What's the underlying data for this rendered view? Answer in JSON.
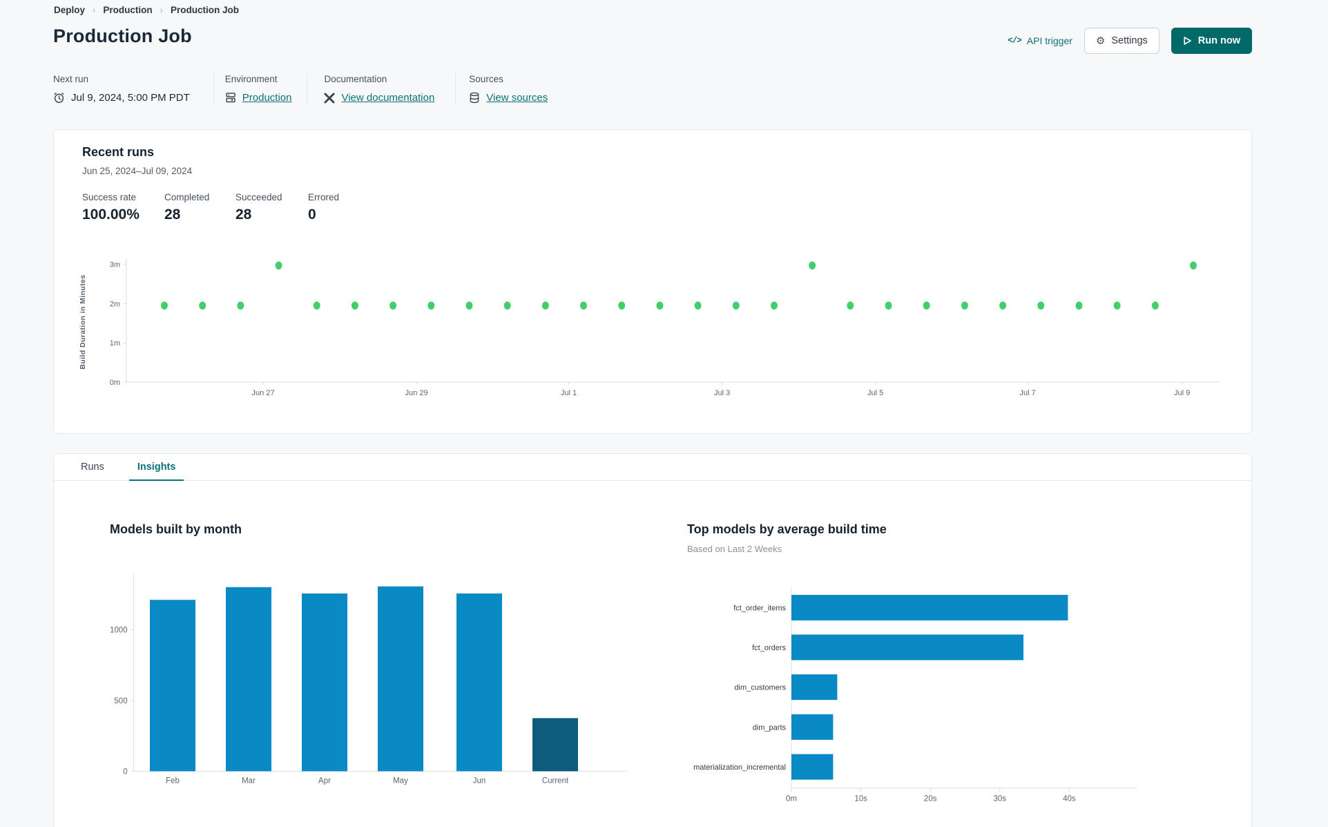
{
  "breadcrumb": {
    "separator": "›",
    "items": [
      {
        "label": "Deploy"
      },
      {
        "label": "Production"
      },
      {
        "label": "Production Job"
      }
    ]
  },
  "header": {
    "title": "Production Job",
    "api_trigger_icon": "</>",
    "api_trigger_label": "API trigger",
    "settings_label": "Settings",
    "run_now_label": "Run now"
  },
  "meta": {
    "next_run": {
      "label": "Next run",
      "value": "Jul 9, 2024, 5:00 PM PDT"
    },
    "environment": {
      "label": "Environment",
      "link": "Production"
    },
    "documentation": {
      "label": "Documentation",
      "link": "View documentation"
    },
    "sources": {
      "label": "Sources",
      "link": "View sources"
    }
  },
  "recent_runs": {
    "title": "Recent runs",
    "date_range": "Jun 25, 2024–Jul 09, 2024",
    "stats": [
      {
        "label": "Success rate",
        "value": "100.00%"
      },
      {
        "label": "Completed",
        "value": "28"
      },
      {
        "label": "Succeeded",
        "value": "28"
      },
      {
        "label": "Errored",
        "value": "0"
      }
    ]
  },
  "tabs": [
    {
      "label": "Runs",
      "active": false
    },
    {
      "label": "Insights",
      "active": true
    }
  ],
  "colors": {
    "accent_teal": "#0c7277",
    "button_teal": "#026969",
    "bar_blue": "#0a8ac4",
    "bar_dark_blue": "#0d5c7e",
    "dot_green": "#41cf6d",
    "axis_line": "#d8dce1",
    "axis_text": "#5c6570"
  },
  "chart_data": [
    {
      "id": "build_duration",
      "type": "scatter",
      "ylabel": "Build Duration in Minutes",
      "point_color": "#41cf6d",
      "ylim": [
        0,
        3.3
      ],
      "y_ticks": [
        {
          "label": "0m",
          "value": 0
        },
        {
          "label": "1m",
          "value": 1
        },
        {
          "label": "2m",
          "value": 2
        },
        {
          "label": "3m",
          "value": 3
        }
      ],
      "x_ticks": [
        {
          "label": "Jun 27",
          "frac": 0.096
        },
        {
          "label": "Jun 29",
          "frac": 0.245
        },
        {
          "label": "Jul 1",
          "frac": 0.393
        },
        {
          "label": "Jul 3",
          "frac": 0.542
        },
        {
          "label": "Jul 5",
          "frac": 0.691
        },
        {
          "label": "Jul 7",
          "frac": 0.839
        },
        {
          "label": "Jul 9",
          "frac": 0.989
        }
      ],
      "points_minutes": [
        1.95,
        1.95,
        1.95,
        2.97,
        1.95,
        1.95,
        1.95,
        1.95,
        1.95,
        1.95,
        1.95,
        1.95,
        1.95,
        1.95,
        1.95,
        1.95,
        1.95,
        2.97,
        1.95,
        1.95,
        1.95,
        1.95,
        1.95,
        1.95,
        1.95,
        1.95,
        1.95,
        2.97
      ]
    },
    {
      "id": "models_by_month",
      "type": "bar",
      "title": "Models built by month",
      "categories": [
        "Feb",
        "Mar",
        "Apr",
        "May",
        "Jun",
        "Current"
      ],
      "values": [
        1210,
        1300,
        1255,
        1305,
        1255,
        375
      ],
      "y_ticks": [
        0,
        500,
        1000
      ],
      "ylim": [
        0,
        1440
      ],
      "bar_color": "#0a8ac4",
      "highlight_index": 5,
      "highlight_color": "#0d5c7e"
    },
    {
      "id": "top_models",
      "type": "bar-horizontal",
      "title": "Top models by average build time",
      "subtitle": "Based on Last 2 Weeks",
      "categories": [
        "fct_order_items",
        "fct_orders",
        "dim_customers",
        "dim_parts",
        "materialization_incremental"
      ],
      "values_seconds": [
        39.8,
        33.4,
        6.6,
        6.0,
        6.0
      ],
      "x_ticks": [
        {
          "label": "0m",
          "value": 0
        },
        {
          "label": "10s",
          "value": 10
        },
        {
          "label": "20s",
          "value": 20
        },
        {
          "label": "30s",
          "value": 30
        },
        {
          "label": "40s",
          "value": 40
        }
      ],
      "xlim": [
        0,
        45
      ],
      "bar_color": "#0a8ac4"
    }
  ]
}
